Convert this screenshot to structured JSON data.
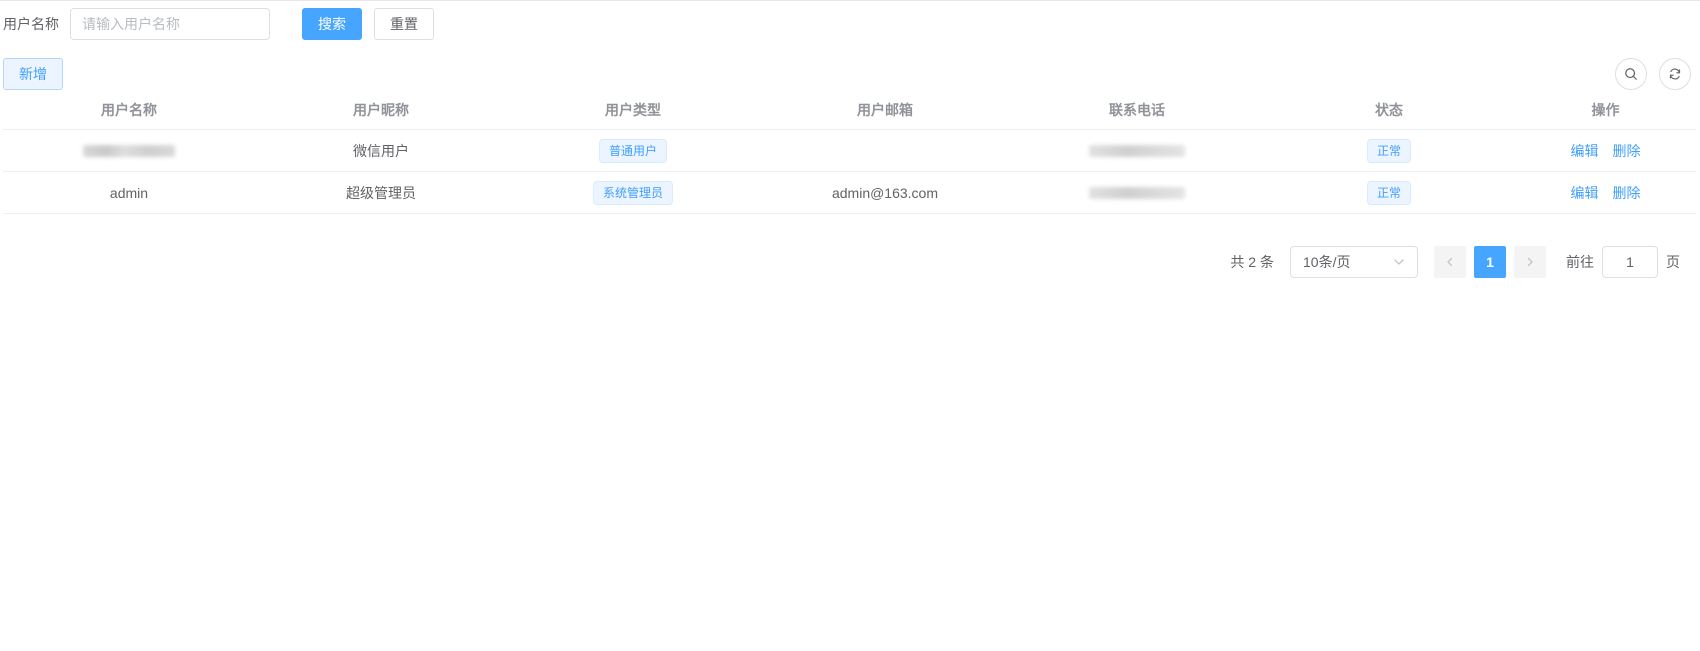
{
  "search": {
    "label": "用户名称",
    "placeholder": "请输入用户名称",
    "search_btn": "搜索",
    "reset_btn": "重置"
  },
  "toolbar": {
    "add_btn": "新增",
    "search_icon": "search-icon",
    "refresh_icon": "refresh-icon"
  },
  "table": {
    "headers": [
      "用户名称",
      "用户昵称",
      "用户类型",
      "用户邮箱",
      "联系电话",
      "状态",
      "操作"
    ],
    "rows": [
      {
        "username": "",
        "nickname": "微信用户",
        "type": "普通用户",
        "email": "",
        "phone": "",
        "status": "正常",
        "edit": "编辑",
        "delete": "删除"
      },
      {
        "username": "admin",
        "nickname": "超级管理员",
        "type": "系统管理员",
        "email": "admin@163.com",
        "phone": "",
        "status": "正常",
        "edit": "编辑",
        "delete": "删除"
      }
    ]
  },
  "pagination": {
    "total": "共 2 条",
    "page_size": "10条/页",
    "current_page": "1",
    "goto_label": "前往",
    "goto_value": "1",
    "page_unit": "页"
  },
  "colors": {
    "primary": "#46a6ff",
    "link": "#409eff",
    "tag_bg": "#ecf5ff"
  }
}
